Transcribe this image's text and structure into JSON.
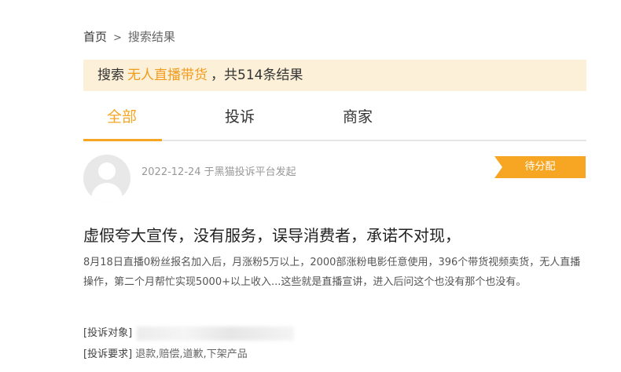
{
  "breadcrumb": {
    "home": "首页",
    "separator": ">",
    "current": "搜索结果"
  },
  "search": {
    "prefix": "搜索",
    "keyword": "无人直播带货",
    "suffix": "，共514条结果"
  },
  "tabs": [
    {
      "label": "全部",
      "active": true
    },
    {
      "label": "投诉",
      "active": false
    },
    {
      "label": "商家",
      "active": false
    }
  ],
  "post": {
    "meta": "2022-12-24 于黑猫投诉平台发起",
    "status": "待分配",
    "title": "虚假夸大宣传，没有服务，误导消费者，承诺不对现，",
    "excerpt": "8月18日直播0粉丝报名加入后，月涨粉5万以上，2000部涨粉电影任意使用，396个带货视频卖货，无人直播操作，第二个月帮忙实现5000+以上收入...这些就是直播宣讲，进入后问这个也没有那个也没有。",
    "target_label": "[投诉对象]",
    "demand_label": "[投诉要求]",
    "demand_value": "退款,赔偿,道歉,下架产品"
  },
  "colors": {
    "accent": "#f6a623",
    "banner_bg": "#fdf0d8",
    "keyword": "#f29b1d"
  }
}
